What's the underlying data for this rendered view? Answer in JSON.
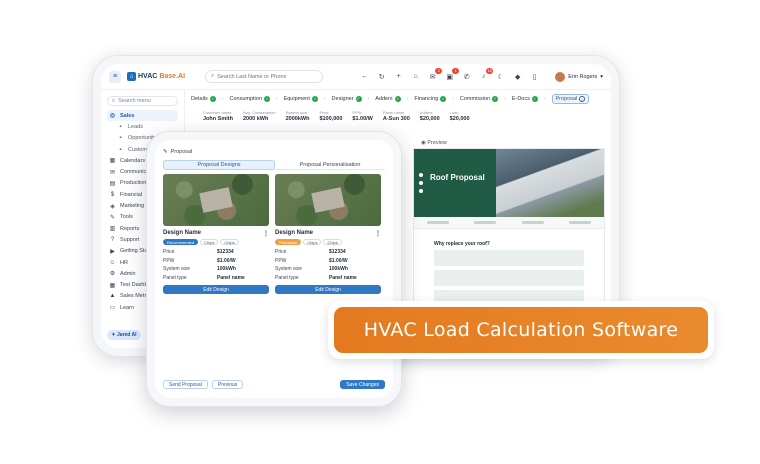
{
  "app": {
    "logo_prefix": "HVAC",
    "logo_accent": "Base.AI",
    "search_placeholder": "Search Last Name or Phone",
    "user_name": "Erin Rogers",
    "badges": {
      "mail": "2",
      "chat": "1",
      "bell": "10"
    }
  },
  "sidebar": {
    "search_placeholder": "Search menu",
    "items": [
      {
        "label": "Sales",
        "icon": "◎"
      },
      {
        "label": "Leads",
        "icon": "▪"
      },
      {
        "label": "Opportunity",
        "icon": "▪"
      },
      {
        "label": "Customer",
        "icon": "▪"
      },
      {
        "label": "Calendars",
        "icon": "▦"
      },
      {
        "label": "Communications",
        "icon": "✉"
      },
      {
        "label": "Production",
        "icon": "▤"
      },
      {
        "label": "Financial",
        "icon": "$"
      },
      {
        "label": "Marketing",
        "icon": "◈"
      },
      {
        "label": "Tools",
        "icon": "✎"
      },
      {
        "label": "Reports",
        "icon": "▥"
      },
      {
        "label": "Support",
        "icon": "?"
      },
      {
        "label": "Getting Started",
        "icon": "▶"
      },
      {
        "label": "HR",
        "icon": "☺"
      },
      {
        "label": "Admin",
        "icon": "⚙"
      },
      {
        "label": "Test Dashboard",
        "icon": "▦"
      },
      {
        "label": "Sales Metrics",
        "icon": "▲"
      },
      {
        "label": "Learn",
        "icon": "▭"
      }
    ],
    "jared_label": "Jared AI"
  },
  "steps": [
    {
      "label": "Details"
    },
    {
      "label": "Consumption"
    },
    {
      "label": "Equipment"
    },
    {
      "label": "Designer"
    },
    {
      "label": "Adders"
    },
    {
      "label": "Financing"
    },
    {
      "label": "Commission"
    },
    {
      "label": "E-Docs"
    },
    {
      "label": "Proposal"
    }
  ],
  "fields": [
    {
      "label": "Customer name",
      "value": "John Smith"
    },
    {
      "label": "Avg. Consumption",
      "value": "2000 kWh"
    },
    {
      "label": "System size",
      "value": "2000kWh"
    },
    {
      "label": "Price",
      "value": "$100,000"
    },
    {
      "label": "PPW",
      "value": "$1.00/W"
    },
    {
      "label": "Panel name",
      "value": "A-Sun 300"
    },
    {
      "label": "Adders",
      "value": "$20,000"
    },
    {
      "label": "Loan",
      "value": "$20,000"
    }
  ],
  "preview": {
    "label": "Preview",
    "title": "Roof Proposal",
    "why": "Why replace your roof?"
  },
  "phone": {
    "header": "Proposal",
    "tabs": [
      "Proposal Designs",
      "Proposal Personalisation"
    ],
    "cards": [
      {
        "name": "Design Name",
        "chips": [
          "Recommended",
          "Chips",
          "Chips"
        ],
        "rows": [
          {
            "k": "Price",
            "v": "$12334"
          },
          {
            "k": "PPW",
            "v": "$1.00/W"
          },
          {
            "k": "System size",
            "v": "100kWh"
          },
          {
            "k": "Panel type",
            "v": "Panel name"
          }
        ],
        "button": "Edit Design"
      },
      {
        "name": "Design Name",
        "chips": [
          "Promotion",
          "Chips",
          "Chips"
        ],
        "rows": [
          {
            "k": "Price",
            "v": "$12334"
          },
          {
            "k": "PPW",
            "v": "$1.00/W"
          },
          {
            "k": "System size",
            "v": "100kWh"
          },
          {
            "k": "Panel type",
            "v": "Panel name"
          }
        ],
        "button": "Edit Design"
      }
    ],
    "footer": {
      "send": "Send Proposal",
      "previous": "Previous",
      "save": "Save Changes"
    }
  },
  "banner": {
    "text": "HVAC Load Calculation Software"
  },
  "colors": {
    "accent": "#2f78c6",
    "banner": "#e47a1f",
    "proposal_green": "#1f5b45"
  }
}
